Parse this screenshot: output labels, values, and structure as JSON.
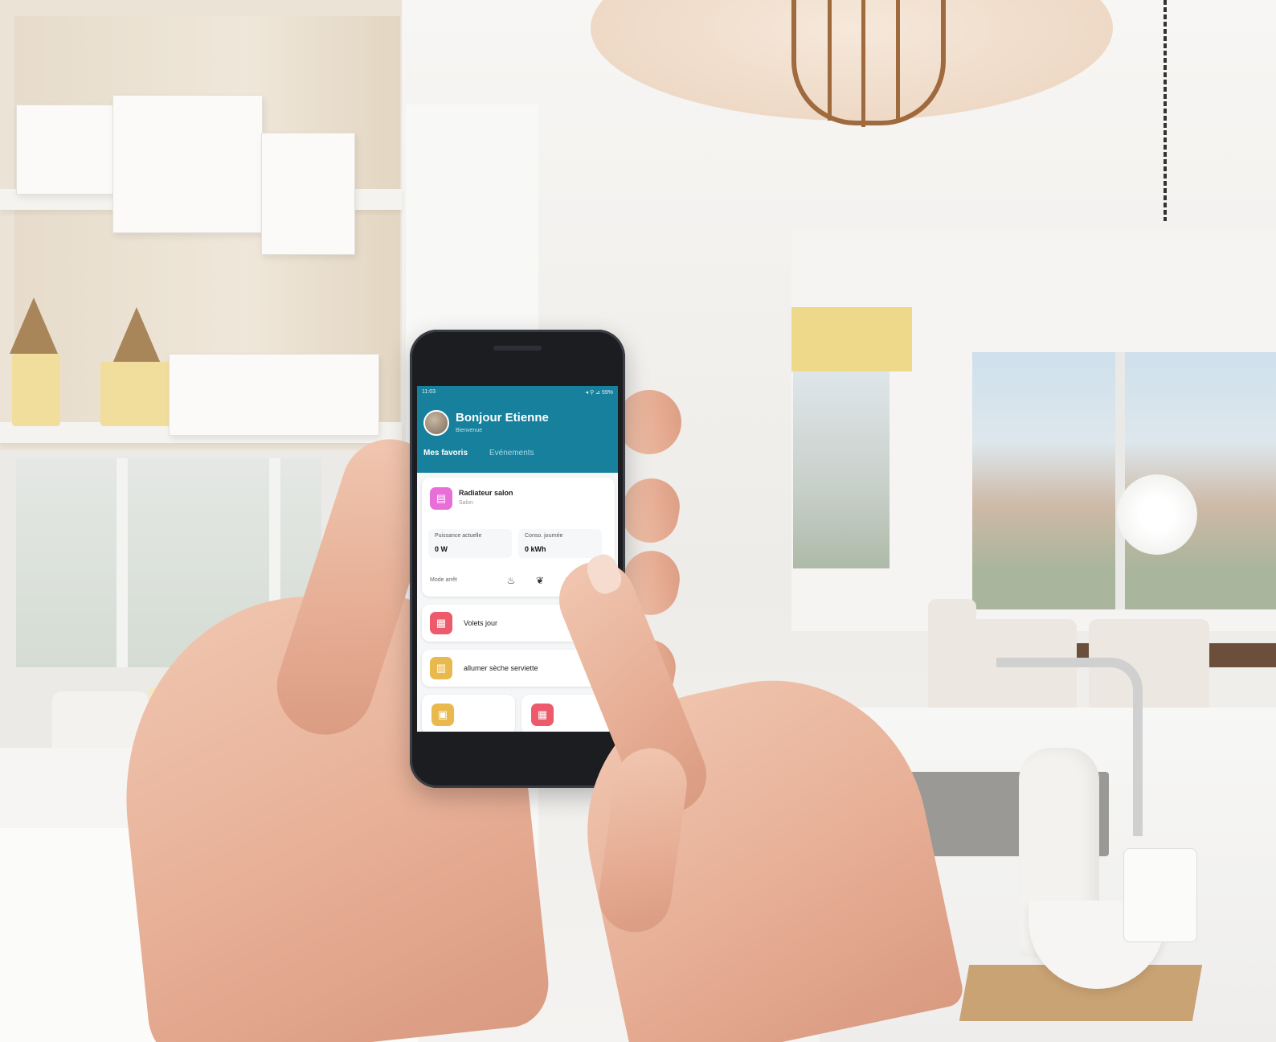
{
  "phone_app": {
    "status_time": "11:03",
    "status_right": "◂ ⚲ ⊿ 59%",
    "greeting": "Bonjour Etienne",
    "greeting_sub": "Bienvenue",
    "tabs": [
      {
        "label": "Mes favoris",
        "active": true
      },
      {
        "label": "Evénements",
        "active": false
      }
    ],
    "radiator_card": {
      "title": "Radiateur salon",
      "room": "Salon",
      "icon": "radiator-icon",
      "icon_color": "#e86fd8",
      "power_label": "Puissance actuelle",
      "power_value": "0 W",
      "consumption_label": "Conso. journée",
      "consumption_value": "0 kWh",
      "mode_label": "Mode arrêt",
      "mode_icons": [
        "flame-icon",
        "leaf-icon",
        "snowflake-icon",
        "power-icon"
      ]
    },
    "scenes": [
      {
        "label": "Volets jour",
        "icon": "shutter-icon",
        "icon_color": "#ec5a6b"
      },
      {
        "label": "allumer sèche serviette",
        "icon": "towel-dryer-icon",
        "icon_color": "#eab94e"
      }
    ],
    "bottom_tiles": [
      {
        "icon": "calendar-icon",
        "icon_color": "#eab94e"
      },
      {
        "icon": "shutter-icon",
        "icon_color": "#ec5a6b"
      }
    ],
    "accent_color": "#16809d"
  }
}
